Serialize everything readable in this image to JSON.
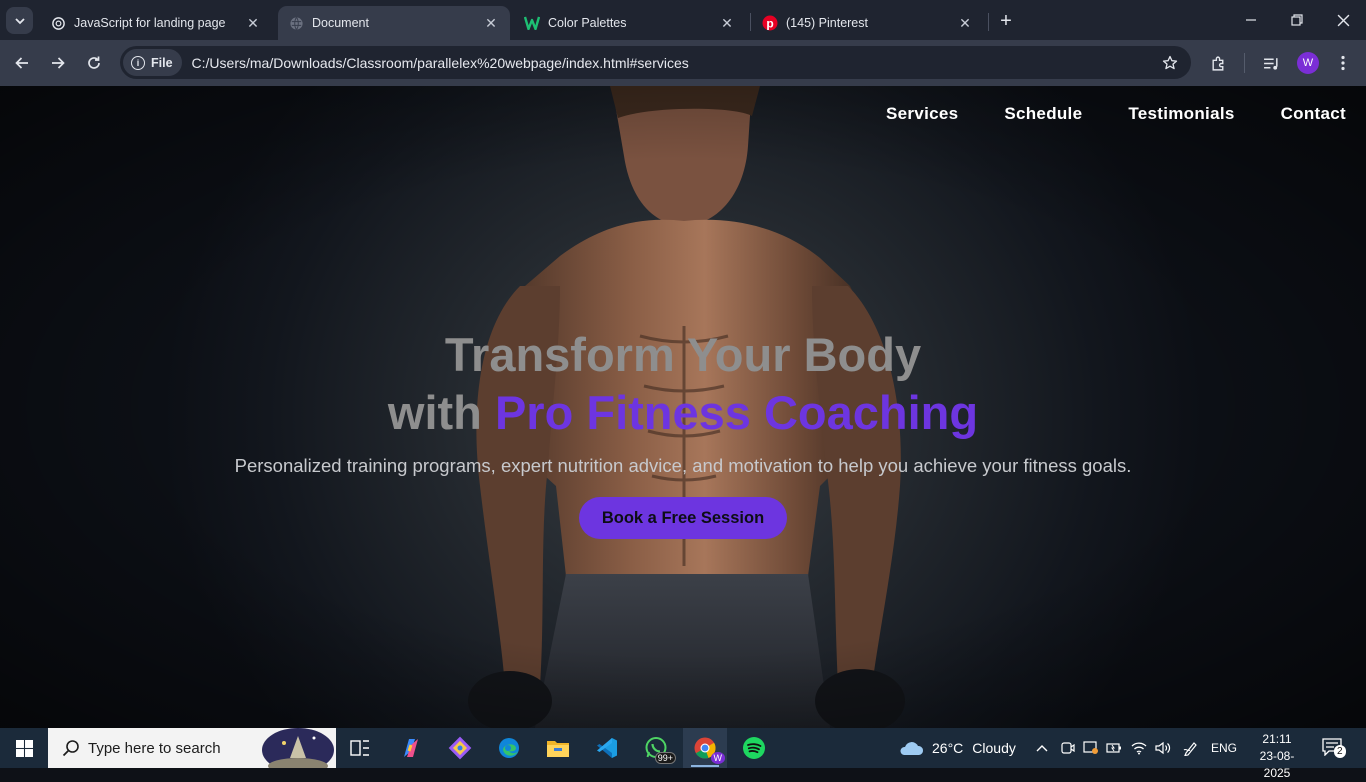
{
  "browser": {
    "tabs": [
      {
        "title": "JavaScript for landing page",
        "favicon": "openai-icon",
        "active": false
      },
      {
        "title": "Document",
        "favicon": "globe-icon",
        "active": true
      },
      {
        "title": "Color Palettes",
        "favicon": "w-logo-icon",
        "active": false
      },
      {
        "title": "(145) Pinterest",
        "favicon": "pinterest-icon",
        "active": false
      }
    ],
    "site_chip": "File",
    "url": "C:/Users/ma/Downloads/Classroom/parallelex%20webpage/index.html#services",
    "profile_initial": "W",
    "accent_color": "#7b2ed6"
  },
  "page": {
    "nav": [
      "Services",
      "Schedule",
      "Testimonials",
      "Contact"
    ],
    "title_line1": "Transform Your Body",
    "title_line2_prefix": "with",
    "title_line2_accent": "Pro Fitness Coaching",
    "subtitle": "Personalized training programs, expert nutrition advice, and motivation to help you achieve your fitness goals.",
    "cta": "Book a Free Session",
    "accent_color": "#6d35e0"
  },
  "taskbar": {
    "search_placeholder": "Type here to search",
    "apps": [
      "task-view-icon",
      "copilot-icon",
      "git-icon",
      "edge-icon",
      "file-explorer-icon",
      "vscode-icon",
      "whatsapp-icon",
      "chrome-icon",
      "spotify-icon"
    ],
    "whatsapp_badge": "99+",
    "chrome_badge": "W",
    "weather_temp": "26°C",
    "weather_text": "Cloudy",
    "language": "ENG",
    "time": "21:11",
    "date": "23-08-2025",
    "notification_count": "2"
  }
}
